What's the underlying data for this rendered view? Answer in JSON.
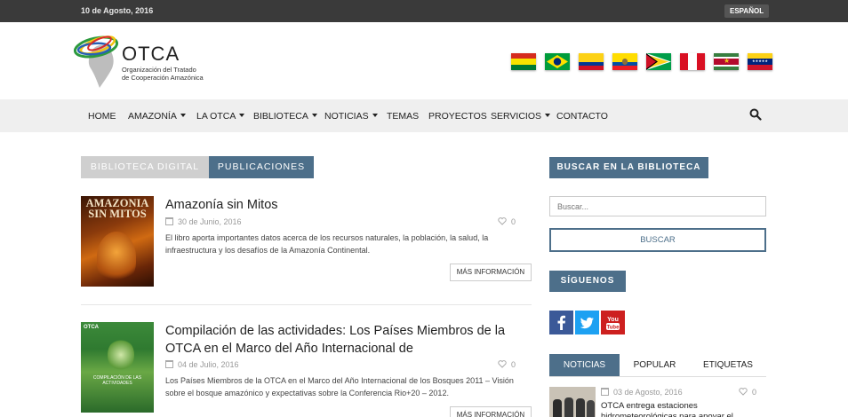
{
  "topbar": {
    "date": "10 de Agosto, 2016",
    "language": "ESPAÑOL"
  },
  "brand": {
    "name": "OTCA",
    "subtitle_line1": "Organización del Tratado",
    "subtitle_line2": "de Cooperación Amazónica"
  },
  "flags": [
    "bolivia-flag",
    "brazil-flag",
    "colombia-flag",
    "ecuador-flag",
    "guyana-flag",
    "peru-flag",
    "suriname-flag",
    "venezuela-flag"
  ],
  "nav": {
    "items": [
      {
        "label": "HOME",
        "dropdown": false
      },
      {
        "label": "AMAZONÍA",
        "dropdown": true
      },
      {
        "label": "LA OTCA",
        "dropdown": true
      },
      {
        "label": "BIBLIOTECA",
        "dropdown": true
      },
      {
        "label": "NOTICIAS",
        "dropdown": true
      },
      {
        "label": "TEMAS",
        "dropdown": false
      },
      {
        "label": "PROYECTOS",
        "dropdown": false
      },
      {
        "label": "SERVICIOS",
        "dropdown": true
      },
      {
        "label": "CONTACTO",
        "dropdown": false
      }
    ],
    "search_icon": "search-icon"
  },
  "tabs": {
    "library": "BIBLIOTECA DIGITAL",
    "publications": "PUBLICACIONES"
  },
  "articles": [
    {
      "cover_title_line1": "AMAZONIA",
      "cover_title_line2": "SIN MITOS",
      "title": "Amazonía sin Mitos",
      "date": "30 de Junio, 2016",
      "likes": "0",
      "excerpt": "El libro aporta importantes datos acerca de los recursos naturales, la población, la salud, la infraestructura y los desafíos de la Amazonía Continental.",
      "more": "MÁS INFORMACIÓN"
    },
    {
      "cover_title_line1": "OTCA",
      "cover_title_line2": "COMPILACIÓN DE LAS ACTIVIDADES",
      "title": "Compilación de las actividades: Los Países Miembros de la OTCA en el Marco del Año Internacional de",
      "date": "04 de Julio, 2016",
      "likes": "0",
      "excerpt": "Los Países Miembros de la OTCA en el Marco del Año Internacional de los Bosques 2011 – Visión sobre el bosque amazónico y expectativas sobre la Conferencia Rio+20 – 2012.",
      "more": "MÁS INFORMACIÓN"
    }
  ],
  "sidebar": {
    "search_heading": "BUSCAR EN LA BIBLIOTECA",
    "search_placeholder": "Buscar...",
    "search_button": "BUSCAR",
    "follow_heading": "SÍGUENOS",
    "social": [
      "facebook-icon",
      "twitter-icon",
      "youtube-icon"
    ],
    "tabs": [
      "NOTICIAS",
      "POPULAR",
      "ETIQUETAS"
    ],
    "news": {
      "date": "03 de Agosto, 2016",
      "likes": "0",
      "title": "OTCA entrega estaciones hidrometeorológicas para apoyar el"
    }
  },
  "colors": {
    "accent": "#4d6f8a",
    "topbar": "#3a3a3a",
    "nav": "#efefef",
    "tab_inactive": "#cfcfcf"
  }
}
